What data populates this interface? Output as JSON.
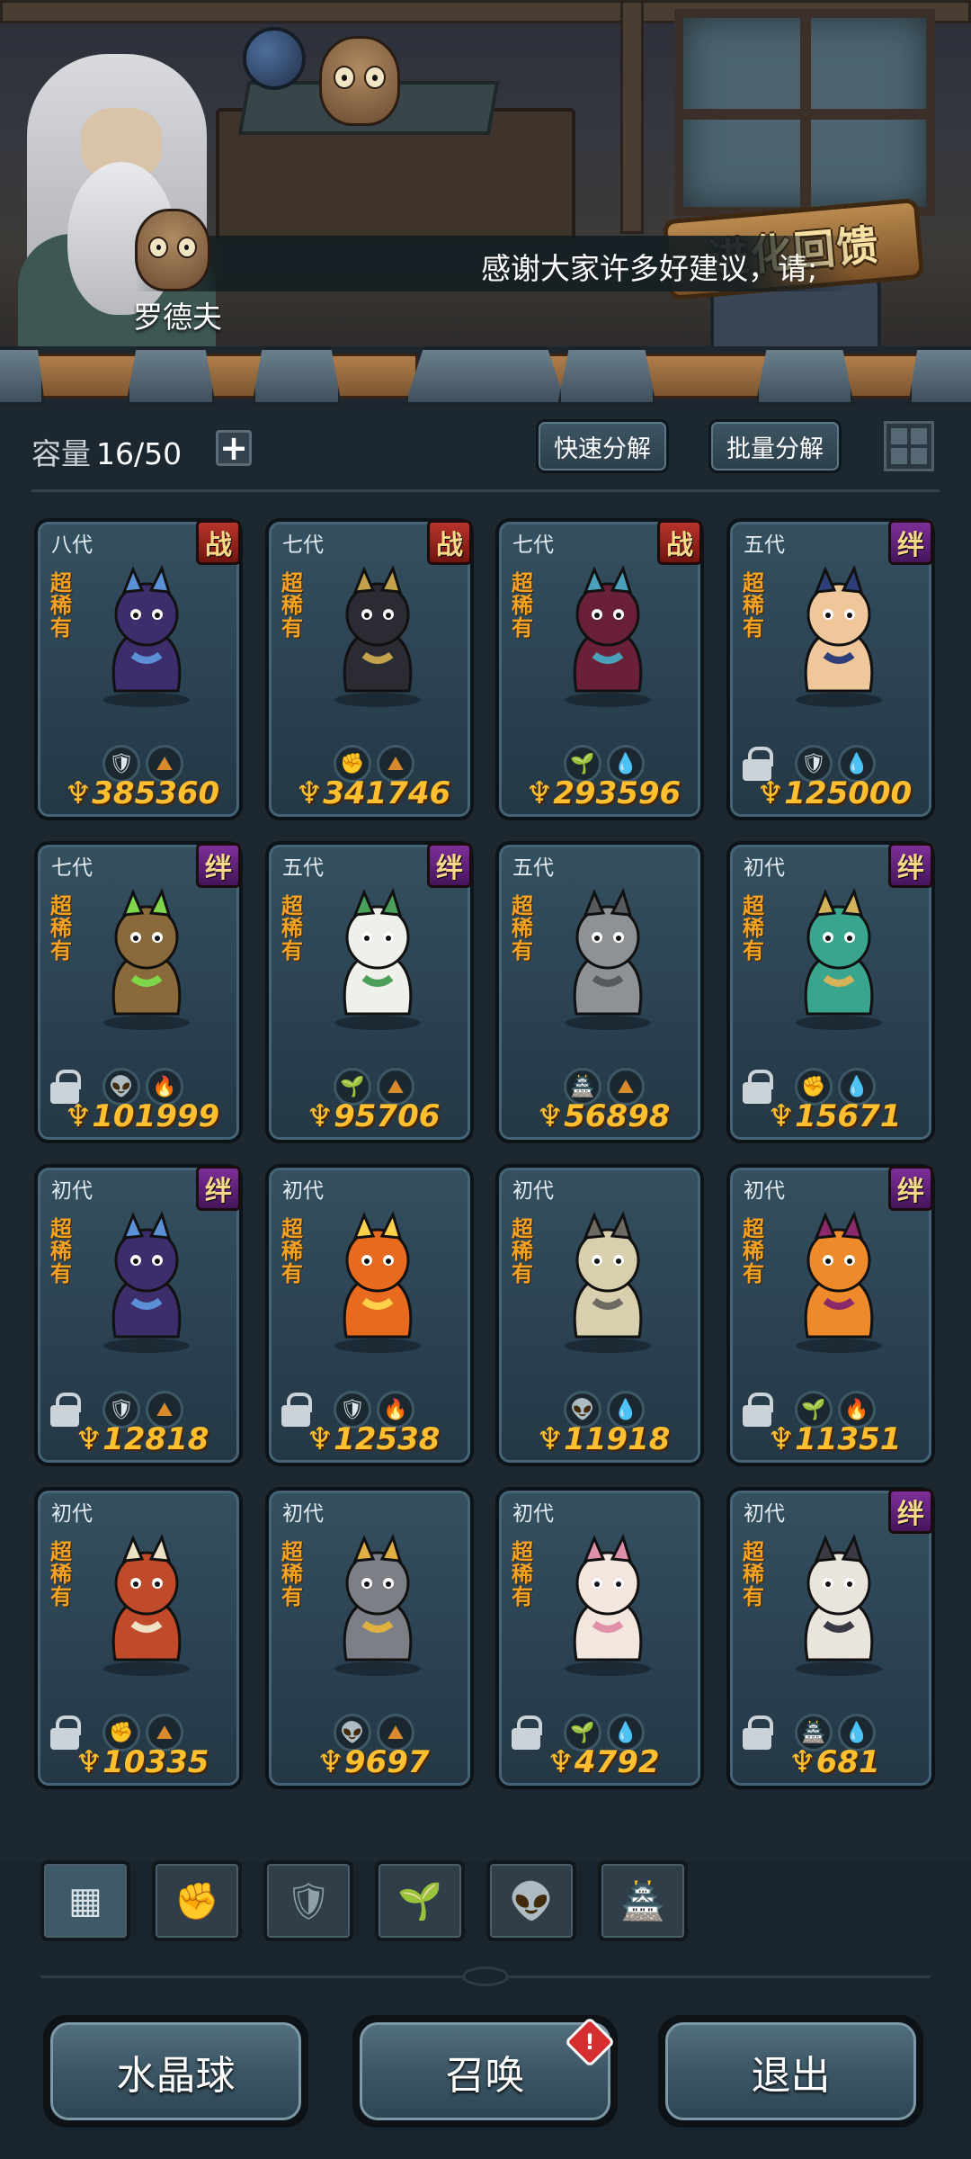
{
  "banner": {
    "evolution_sign": "进化回馈",
    "ticker": "感谢大家许多好建议，请;",
    "speaker": "罗德夫"
  },
  "inventory": {
    "capacity_label": "容量",
    "capacity_value": "16/50",
    "quick_decompose": "快速分解",
    "batch_decompose": "批量分解"
  },
  "cards": [
    {
      "gen": "八代",
      "rarity": "超稀有",
      "badge": "战",
      "power": "385360",
      "locked": false,
      "icons": [
        "shield",
        "earth"
      ],
      "art": "witch"
    },
    {
      "gen": "七代",
      "rarity": "超稀有",
      "badge": "战",
      "power": "341746",
      "locked": false,
      "icons": [
        "fist",
        "earth"
      ],
      "art": "wolf"
    },
    {
      "gen": "七代",
      "rarity": "超稀有",
      "badge": "战",
      "power": "293596",
      "locked": false,
      "icons": [
        "leaf",
        "water"
      ],
      "art": "spider"
    },
    {
      "gen": "五代",
      "rarity": "超稀有",
      "badge": "绊",
      "power": "125000",
      "locked": true,
      "icons": [
        "shield",
        "water"
      ],
      "art": "bunny"
    },
    {
      "gen": "七代",
      "rarity": "超稀有",
      "badge": "绊",
      "power": "101999",
      "locked": true,
      "icons": [
        "alien",
        "fire"
      ],
      "art": "lizard"
    },
    {
      "gen": "五代",
      "rarity": "超稀有",
      "badge": "绊",
      "power": "95706",
      "locked": false,
      "icons": [
        "leaf",
        "earth"
      ],
      "art": "owl"
    },
    {
      "gen": "五代",
      "rarity": "超稀有",
      "badge": "",
      "power": "56898",
      "locked": false,
      "icons": [
        "tower",
        "earth"
      ],
      "art": "knight"
    },
    {
      "gen": "初代",
      "rarity": "超稀有",
      "badge": "绊",
      "power": "15671",
      "locked": true,
      "icons": [
        "fist",
        "water"
      ],
      "art": "wave"
    },
    {
      "gen": "初代",
      "rarity": "超稀有",
      "badge": "绊",
      "power": "12818",
      "locked": true,
      "icons": [
        "shield",
        "earth"
      ],
      "art": "witch"
    },
    {
      "gen": "初代",
      "rarity": "超稀有",
      "badge": "",
      "power": "12538",
      "locked": true,
      "icons": [
        "shield",
        "fire"
      ],
      "art": "flame"
    },
    {
      "gen": "初代",
      "rarity": "超稀有",
      "badge": "",
      "power": "11918",
      "locked": false,
      "icons": [
        "alien",
        "water"
      ],
      "art": "serpent"
    },
    {
      "gen": "初代",
      "rarity": "超稀有",
      "badge": "绊",
      "power": "11351",
      "locked": true,
      "icons": [
        "leaf",
        "fire"
      ],
      "art": "fairy"
    },
    {
      "gen": "初代",
      "rarity": "超稀有",
      "badge": "",
      "power": "10335",
      "locked": true,
      "icons": [
        "fist",
        "earth"
      ],
      "art": "blob"
    },
    {
      "gen": "初代",
      "rarity": "超稀有",
      "badge": "",
      "power": "9697",
      "locked": false,
      "icons": [
        "alien",
        "earth"
      ],
      "art": "dragonfly"
    },
    {
      "gen": "初代",
      "rarity": "超稀有",
      "badge": "",
      "power": "4792",
      "locked": true,
      "icons": [
        "leaf",
        "water"
      ],
      "art": "sheep"
    },
    {
      "gen": "初代",
      "rarity": "超稀有",
      "badge": "绊",
      "power": "681",
      "locked": true,
      "icons": [
        "tower",
        "water"
      ],
      "art": "dragon"
    }
  ],
  "tabs": [
    "all-icon",
    "fist-icon",
    "shield-icon",
    "leaf-icon",
    "alien-icon",
    "tower-icon"
  ],
  "buttons": {
    "crystal_ball": "水晶球",
    "summon": "召唤",
    "summon_alert": "!",
    "exit": "退出"
  },
  "colors": {
    "power": "#ffbf2e",
    "rarity": "#f3a221",
    "badge_war": "#b8342b",
    "badge_bond": "#7d2f9a",
    "card_bg": "#2b4252"
  }
}
